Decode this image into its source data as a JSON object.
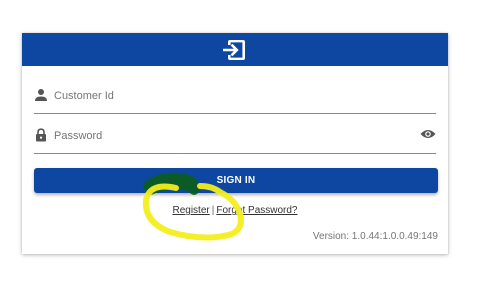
{
  "header": {
    "icon": "login-icon",
    "color": "#0d47a1"
  },
  "form": {
    "customer_id": {
      "placeholder": "Customer Id",
      "value": "",
      "icon": "person-icon"
    },
    "password": {
      "placeholder": "Password",
      "value": "",
      "icon": "lock-icon",
      "toggle_icon": "eye-icon"
    }
  },
  "actions": {
    "signin_label": "SIGN IN",
    "register_label": "Register",
    "separator": "|",
    "forgot_label": "Forgot Password?"
  },
  "footer": {
    "version": "Version: 1.0.44:1.0.0.49:149"
  },
  "annotation": {
    "marker_colors": [
      "#0b5d1e",
      "#f3ee1c"
    ]
  }
}
